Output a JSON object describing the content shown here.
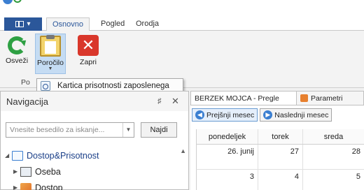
{
  "app": {
    "menu_button_label": "",
    "tabs": [
      {
        "label": "Osnovno",
        "active": true
      },
      {
        "label": "Pogled",
        "active": false
      },
      {
        "label": "Orodja",
        "active": false
      }
    ]
  },
  "ribbon": {
    "refresh_label": "Osveži",
    "report_label": "Poročilo",
    "close_label": "Zapri",
    "group_label": "Po"
  },
  "report_menu": {
    "items": [
      {
        "label": "Kartica prisotnosti zaposlenega",
        "icon": "report-search-icon"
      }
    ]
  },
  "navigation": {
    "title": "Navigacija",
    "pin_glyph": "♯",
    "close_glyph": "✕",
    "search_placeholder": "Vnesite besedilo za iskanje...",
    "find_button": "Najdi",
    "tree": [
      {
        "label": "Dostop&Prisotnost",
        "icon": "document-icon",
        "expanded": true
      },
      {
        "label": "Oseba",
        "icon": "id-card-icon"
      },
      {
        "label": "Dostop",
        "icon": "key-icon"
      }
    ]
  },
  "documents": {
    "tabs": [
      {
        "label": "BERZEK MOJCA - Pregle",
        "icon": "calendar-icon",
        "active": true
      },
      {
        "label": "Parametri",
        "icon": "parameters-icon",
        "active": false
      }
    ],
    "prev_month": "Prejšnji mesec",
    "next_month": "Naslednji mesec",
    "calendar": {
      "days": [
        "ponedeljek",
        "torek",
        "sreda"
      ],
      "row1": [
        "26. junij",
        "27",
        "28"
      ],
      "row2": [
        "3",
        "4",
        "5"
      ]
    }
  },
  "colors": {
    "accent": "#2b579a",
    "selected_ribbon": "#c5dcf3",
    "refresh_green": "#2ea043",
    "close_red": "#d9372b"
  }
}
